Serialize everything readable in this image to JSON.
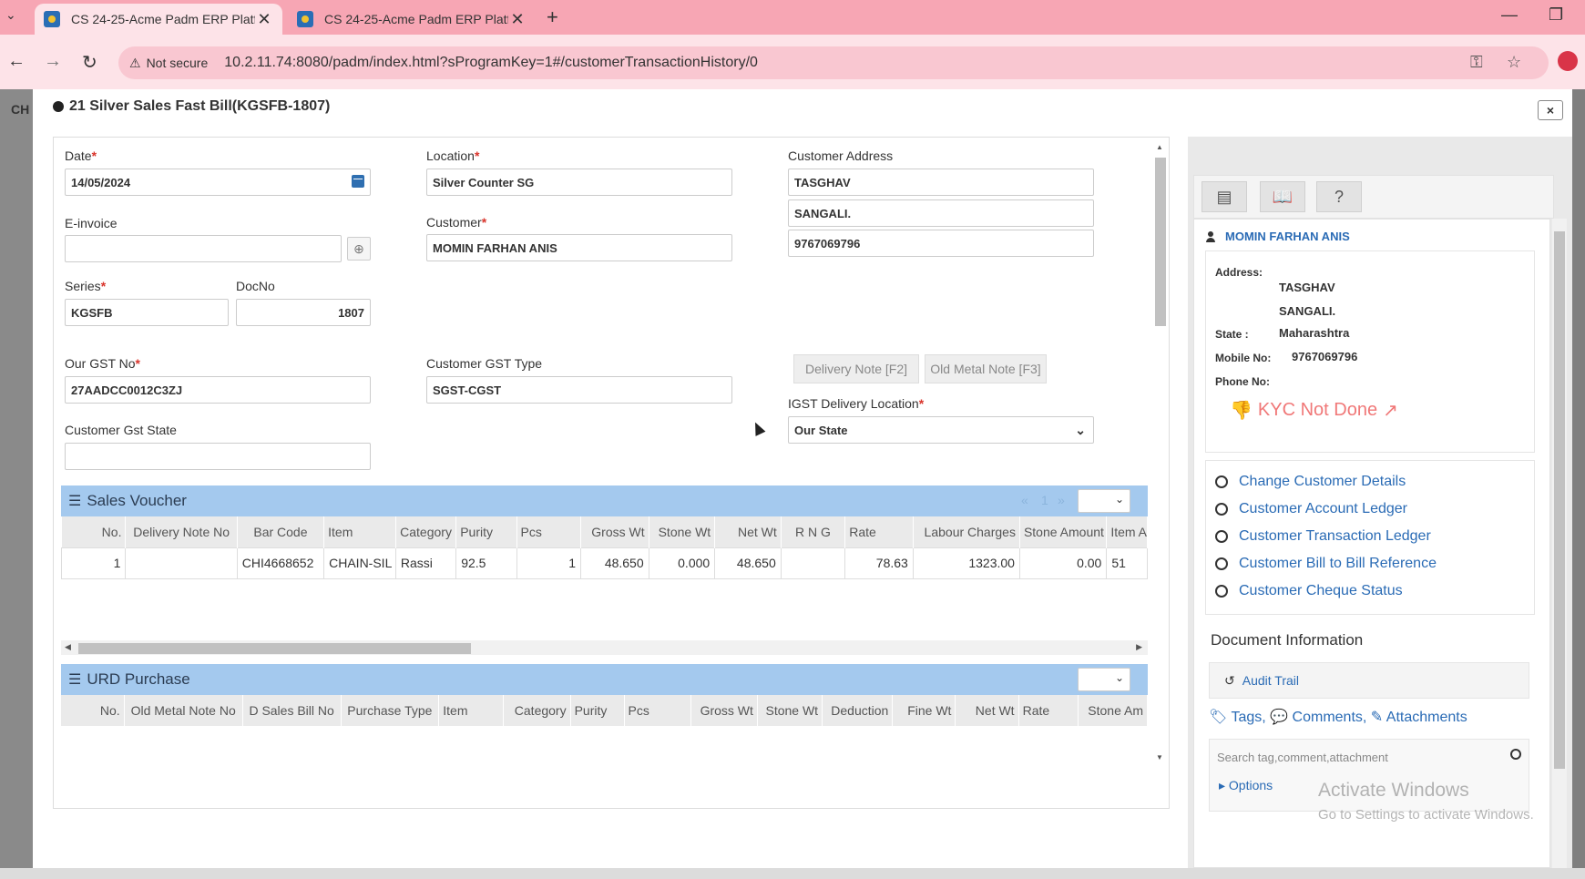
{
  "browser": {
    "tabs": [
      {
        "title": "CS 24-25-Acme Padm ERP Platf",
        "active": true
      },
      {
        "title": "CS 24-25-Acme Padm ERP Platf",
        "active": false
      }
    ],
    "security_label": "Not secure",
    "url": "10.2.11.74:8080/padm/index.html?sProgramKey=1#/customerTransactionHistory/0"
  },
  "modal": {
    "title": "21 Silver Sales Fast Bill(KGSFB-1807)",
    "close_label": "×"
  },
  "form": {
    "date_label": "Date",
    "date_value": "14/05/2024",
    "einvoice_label": "E-invoice",
    "einvoice_value": "",
    "series_label": "Series",
    "series_value": "KGSFB",
    "docno_label": "DocNo",
    "docno_value": "1807",
    "our_gst_label": "Our GST No",
    "our_gst_value": "27AADCC0012C3ZJ",
    "cust_gst_state_label": "Customer Gst State",
    "cust_gst_state_value": "",
    "location_label": "Location",
    "location_value": "Silver Counter SG",
    "customer_label": "Customer",
    "customer_value": "MOMIN FARHAN ANIS",
    "cust_gst_type_label": "Customer GST Type",
    "cust_gst_type_value": "SGST-CGST",
    "cust_address_label": "Customer Address",
    "address_line1": "TASGHAV",
    "address_line2": "SANGALI.",
    "address_line3": "9767069796",
    "delivery_note_btn": "Delivery Note [F2]",
    "old_metal_note_btn": "Old Metal Note [F3]",
    "igst_label": "IGST Delivery Location",
    "igst_value": "Our State",
    "required_mark": "*"
  },
  "sales_voucher": {
    "title": "Sales Voucher",
    "pager": {
      "first": "«",
      "page": "1",
      "last": "»"
    },
    "columns": [
      "No.",
      "Delivery Note No",
      "Bar Code",
      "Item",
      "Category",
      "Purity",
      "Pcs",
      "Gross Wt",
      "Stone Wt",
      "Net Wt",
      "R N G",
      "Rate",
      "Labour Charges",
      "Stone Amount",
      "Item A"
    ],
    "rows": [
      [
        "1",
        "",
        "CHI4668652",
        "CHAIN-SIL",
        "Rassi",
        "92.5",
        "1",
        "48.650",
        "0.000",
        "48.650",
        "",
        "78.63",
        "1323.00",
        "0.00",
        "51"
      ]
    ]
  },
  "urd_purchase": {
    "title": "URD Purchase",
    "columns": [
      "No.",
      "Old Metal Note No",
      "D Sales Bill No",
      "Purchase Type",
      "Item",
      "Category",
      "Purity",
      "Pcs",
      "Gross Wt",
      "Stone Wt",
      "Deduction",
      "Fine Wt",
      "Net Wt",
      "Rate",
      "Stone Am"
    ]
  },
  "side": {
    "customer_name": "MOMIN FARHAN ANIS",
    "address_label": "Address:",
    "address_line1": "TASGHAV",
    "address_line2": "SANGALI.",
    "state_label": "State :",
    "state_value": "Maharashtra",
    "mobile_label": "Mobile No:",
    "mobile_value": "9767069796",
    "phone_label": "Phone No:",
    "phone_value": "",
    "kyc_label": "KYC Not Done",
    "links": [
      "Change Customer Details",
      "Customer Account Ledger",
      "Customer Transaction Ledger",
      "Customer Bill to Bill Reference",
      "Customer Cheque Status"
    ],
    "doc_info_title": "Document Information",
    "audit_trail": "Audit Trail",
    "tags": "Tags,",
    "comments": "Comments,",
    "attachments": "Attachments",
    "search_placeholder": "Search tag,comment,attachment",
    "options": "Options"
  },
  "watermark": {
    "line1": "Activate Windows",
    "line2": "Go to Settings to activate Windows."
  }
}
